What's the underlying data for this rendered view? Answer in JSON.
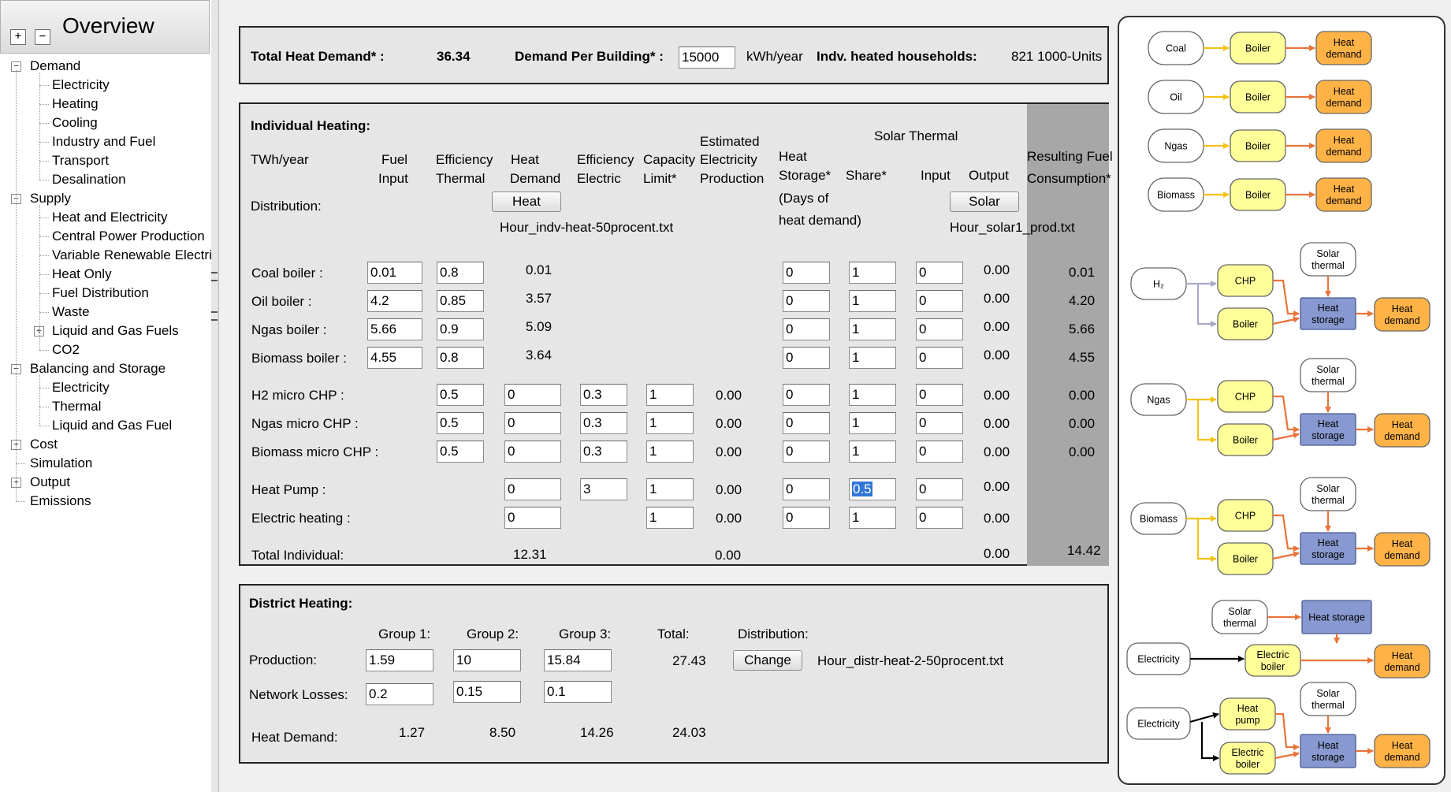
{
  "sidebar": {
    "title": "Overview",
    "expand_all": "+",
    "collapse_all": "−",
    "items": [
      {
        "label": "Demand",
        "level": 0,
        "expander": "−"
      },
      {
        "label": "Electricity",
        "level": 1
      },
      {
        "label": "Heating",
        "level": 1
      },
      {
        "label": "Cooling",
        "level": 1
      },
      {
        "label": "Industry and Fuel",
        "level": 1
      },
      {
        "label": "Transport",
        "level": 1
      },
      {
        "label": "Desalination",
        "level": 1
      },
      {
        "label": "Supply",
        "level": 0,
        "expander": "−"
      },
      {
        "label": "Heat and Electricity",
        "level": 1
      },
      {
        "label": "Central Power Production",
        "level": 1
      },
      {
        "label": "Variable Renewable Electric",
        "level": 1
      },
      {
        "label": "Heat Only",
        "level": 1
      },
      {
        "label": "Fuel Distribution",
        "level": 1
      },
      {
        "label": "Waste",
        "level": 1
      },
      {
        "label": "Liquid and Gas Fuels",
        "level": 1,
        "expander": "+"
      },
      {
        "label": "CO2",
        "level": 1
      },
      {
        "label": "Balancing and Storage",
        "level": 0,
        "expander": "−"
      },
      {
        "label": "Electricity",
        "level": 1
      },
      {
        "label": "Thermal",
        "level": 1
      },
      {
        "label": "Liquid and Gas Fuel",
        "level": 1
      },
      {
        "label": "Cost",
        "level": 0,
        "expander": "+"
      },
      {
        "label": "Simulation",
        "level": 0
      },
      {
        "label": "Output",
        "level": 0,
        "expander": "+"
      },
      {
        "label": "Emissions",
        "level": 0
      }
    ]
  },
  "top": {
    "total_heat_demand_label": "Total Heat Demand* :",
    "total_heat_demand_value": "36.34",
    "demand_per_building_label": "Demand Per Building* :",
    "demand_per_building_value": "15000",
    "demand_per_building_unit": "kWh/year",
    "households_label": "Indv. heated households:",
    "households_value": "821 1000-Units"
  },
  "individual": {
    "title": "Individual Heating:",
    "unit": "TWh/year",
    "distribution_label": "Distribution:",
    "headers": {
      "fuel_input": [
        "Fuel",
        "Input"
      ],
      "eff_thermal": [
        "Efficiency",
        "Thermal"
      ],
      "heat_demand": [
        "Heat",
        "Demand"
      ],
      "eff_electric": [
        "Efficiency",
        "Electric"
      ],
      "capacity": [
        "Capacity",
        "Limit*"
      ],
      "est_elec": [
        "Estimated",
        "Electricity",
        "Production"
      ],
      "heat_storage": [
        "Heat",
        "Storage*",
        "(Days of",
        "heat demand)"
      ],
      "solar_thermal": "Solar Thermal",
      "share": "Share*",
      "input": "Input",
      "output": "Output",
      "resulting": [
        "Resulting Fuel",
        "Consumption*"
      ]
    },
    "heat_button": "Heat",
    "heat_file": "Hour_indv-heat-50procent.txt",
    "solar_button": "Solar",
    "solar_file": "Hour_solar1_prod.txt",
    "boilers": [
      {
        "label": "Coal boiler :",
        "fuel": "0.01",
        "eff": "0.8",
        "demand": "0.01",
        "storage": "0",
        "share": "1",
        "input": "0",
        "output": "0.00",
        "result": "0.01"
      },
      {
        "label": "Oil boiler :",
        "fuel": "4.2",
        "eff": "0.85",
        "demand": "3.57",
        "storage": "0",
        "share": "1",
        "input": "0",
        "output": "0.00",
        "result": "4.20"
      },
      {
        "label": "Ngas boiler :",
        "fuel": "5.66",
        "eff": "0.9",
        "demand": "5.09",
        "storage": "0",
        "share": "1",
        "input": "0",
        "output": "0.00",
        "result": "5.66"
      },
      {
        "label": "Biomass boiler :",
        "fuel": "4.55",
        "eff": "0.8",
        "demand": "3.64",
        "storage": "0",
        "share": "1",
        "input": "0",
        "output": "0.00",
        "result": "4.55"
      }
    ],
    "chps": [
      {
        "label": "H2 micro CHP :",
        "eff": "0.5",
        "demand": "0",
        "eff_el": "0.3",
        "cap": "1",
        "elec": "0.00",
        "storage": "0",
        "share": "1",
        "input": "0",
        "output": "0.00",
        "result": "0.00"
      },
      {
        "label": "Ngas micro CHP :",
        "eff": "0.5",
        "demand": "0",
        "eff_el": "0.3",
        "cap": "1",
        "elec": "0.00",
        "storage": "0",
        "share": "1",
        "input": "0",
        "output": "0.00",
        "result": "0.00"
      },
      {
        "label": "Biomass micro CHP :",
        "eff": "0.5",
        "demand": "0",
        "eff_el": "0.3",
        "cap": "1",
        "elec": "0.00",
        "storage": "0",
        "share": "1",
        "input": "0",
        "output": "0.00",
        "result": "0.00"
      }
    ],
    "heat_pump": {
      "label": "Heat Pump :",
      "demand": "0",
      "eff_el": "3",
      "cap": "1",
      "elec": "0.00",
      "storage": "0",
      "share": "0.5",
      "input": "0",
      "output": "0.00"
    },
    "electric_heating": {
      "label": "Electric heating :",
      "demand": "0",
      "cap": "1",
      "elec": "0.00",
      "storage": "0",
      "share": "1",
      "input": "0",
      "output": "0.00"
    },
    "total": {
      "label": "Total Individual:",
      "demand": "12.31",
      "elec": "0.00",
      "output": "0.00",
      "result": "14.42"
    }
  },
  "district": {
    "title": "District Heating:",
    "groups": [
      "Group 1:",
      "Group 2:",
      "Group 3:"
    ],
    "total_label": "Total:",
    "distribution_label": "Distribution:",
    "production_label": "Production:",
    "production": [
      "1.59",
      "10",
      "15.84"
    ],
    "production_total": "27.43",
    "change_button": "Change",
    "distribution_file": "Hour_distr-heat-2-50procent.txt",
    "losses_label": "Network Losses:",
    "losses": [
      "0.2",
      "0.15",
      "0.1"
    ],
    "heat_demand_label": "Heat Demand:",
    "heat_demand": [
      "1.27",
      "8.50",
      "14.26"
    ],
    "heat_demand_total": "24.03"
  },
  "diagram": {
    "colors": {
      "fuel": "#ffffff",
      "boiler": "#ffff99",
      "demand": "#ffb347",
      "storage": "#8898d0",
      "arrow_yellow": "#f5c216",
      "arrow_orange": "#e8743b",
      "arrow_grey": "#a8aac8",
      "arrow_black": "#000000"
    },
    "fuels": [
      "Coal",
      "Oil",
      "Ngas",
      "Biomass"
    ],
    "boiler": "Boiler",
    "heat_demand": [
      "Heat",
      "demand"
    ],
    "chp": "CHP",
    "solar": [
      "Solar",
      "thermal"
    ],
    "heat_storage": [
      "Heat",
      "storage"
    ],
    "heat_storage_single": "Heat storage",
    "h2": "H₂",
    "ngas": "Ngas",
    "biomass": "Biomass",
    "electricity": "Electricity",
    "electric_boiler": [
      "Electric",
      "boiler"
    ],
    "heat_pump": [
      "Heat",
      "pump"
    ]
  }
}
